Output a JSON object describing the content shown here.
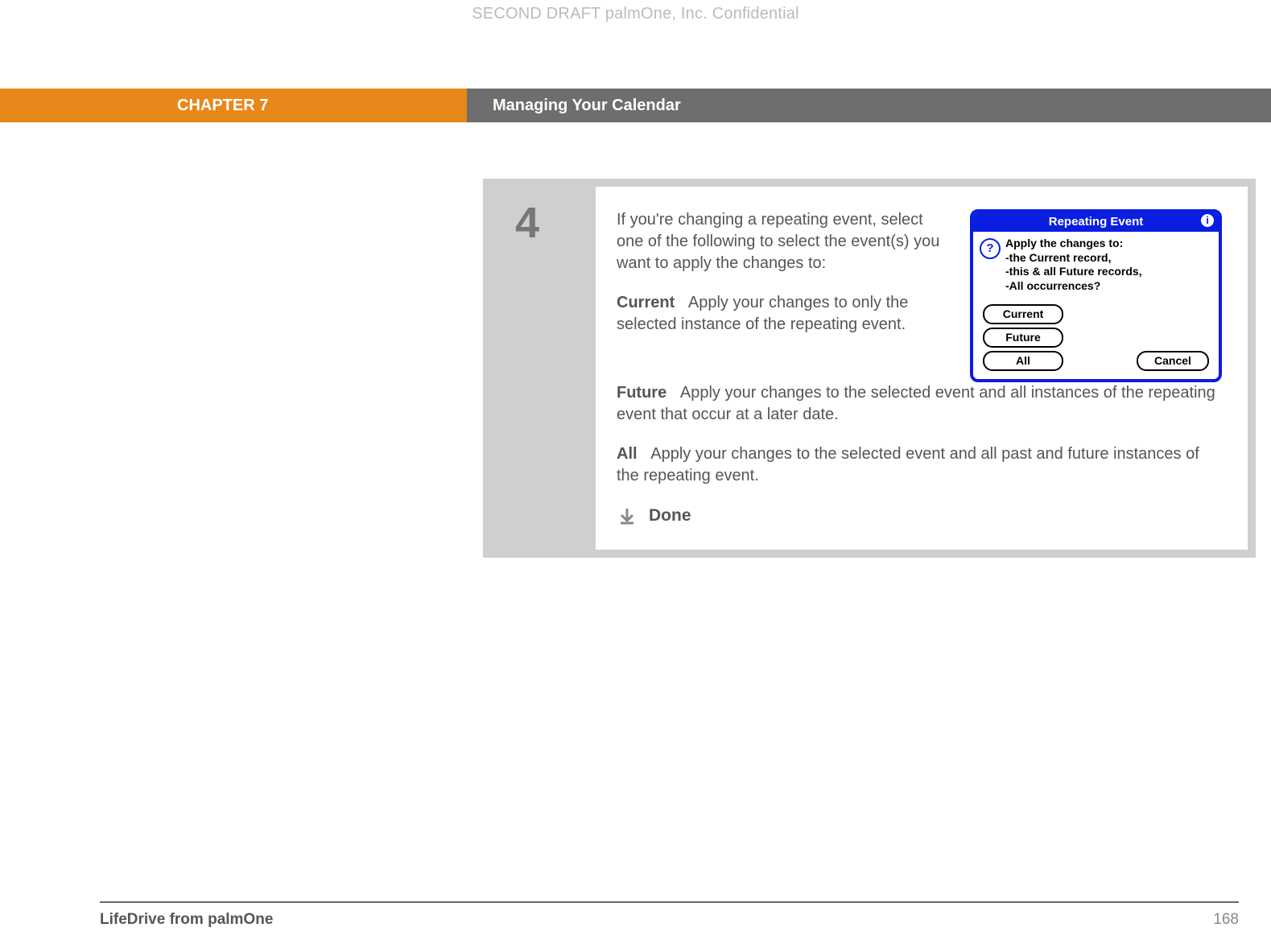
{
  "watermark": "SECOND DRAFT palmOne, Inc.  Confidential",
  "chapter_label": "CHAPTER 7",
  "chapter_title": "Managing Your Calendar",
  "step_number": "4",
  "intro": "If you're changing a repeating event, select one of the following to select the event(s) you want to apply the changes to:",
  "options": {
    "current": {
      "label": "Current",
      "text": "Apply your changes to only the selected instance of the repeating event."
    },
    "future": {
      "label": "Future",
      "text": "Apply your changes to the selected event and all instances of the repeating event that occur at a later date."
    },
    "all": {
      "label": "All",
      "text": "Apply your changes to the selected event and all past and future instances of the repeating event."
    }
  },
  "done_label": "Done",
  "dialog": {
    "title": "Repeating Event",
    "info_glyph": "i",
    "qmark": "?",
    "msg_line1": "Apply the changes to:",
    "msg_line2": "-the Current record,",
    "msg_line3": "-this & all Future records,",
    "msg_line4": "-All occurrences?",
    "btn_current": "Current",
    "btn_future": "Future",
    "btn_all": "All",
    "btn_cancel": "Cancel"
  },
  "footer_product": "LifeDrive from palmOne",
  "page_number": "168"
}
